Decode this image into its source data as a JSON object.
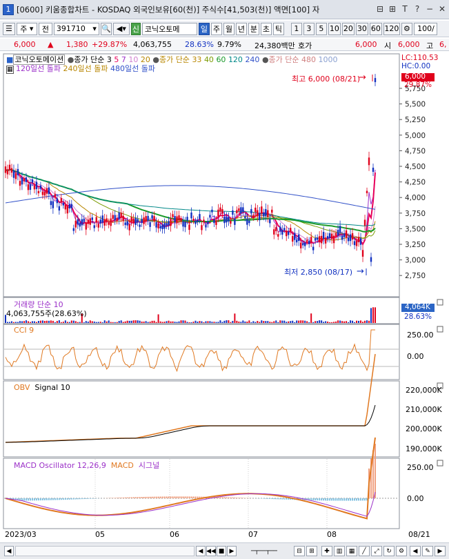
{
  "window": {
    "number": "1",
    "title": "[0600] 키움종합차트 - KOSDAQ 외국인보유[60(천)] 주식수[41,503(천)] 액면[100] 자",
    "buttons": [
      "⊟",
      "⊞",
      "T",
      "?",
      "−",
      "✕"
    ]
  },
  "toolbar": {
    "market": "주",
    "period_type": "전",
    "code": "391710",
    "sin_badge": "신",
    "stock_name": "코닉오토메",
    "tabs": [
      "일",
      "주",
      "월",
      "년",
      "분",
      "초",
      "틱"
    ],
    "active_tab": "일",
    "ticks": [
      "1",
      "3",
      "5",
      "10",
      "20",
      "30",
      "60",
      "120"
    ],
    "count": "100/"
  },
  "pricebar": {
    "price": "6,000",
    "change": "1,380",
    "change_pct": "+29.87%",
    "volume": "4,063,755",
    "turnover": "28.63%",
    "foreign": "9.79%",
    "amount": "24,380백만",
    "hoga_label": "호가",
    "ask": "6,000",
    "si_label": "시",
    "open": "6,000",
    "go_label": "고",
    "high": "6,"
  },
  "main_legend": {
    "stock": "코닉오토메이션",
    "ma_label": "종가 단순",
    "ma_short": [
      "3",
      "5",
      "7",
      "10",
      "20"
    ],
    "ma_label2": "종가 단순",
    "ma_long": [
      "33",
      "40",
      "60",
      "120",
      "240"
    ],
    "ma_label3": "종가 단순",
    "ma_480": "480",
    "ma_1000": "1000",
    "break_20": "120일선 돌파",
    "break_240": "240일선 돌파",
    "break_480": "480일선 돌파"
  },
  "price_axis": {
    "labels": [
      "5,750",
      "5,500",
      "5,250",
      "5,000",
      "4,750",
      "4,500",
      "4,250",
      "4,000",
      "3,750",
      "3,500",
      "3,250",
      "3,000",
      "2,750"
    ],
    "lc": "LC:110.53",
    "hc": "HC:0.00",
    "current": "6,000",
    "current_pct": "29.87%"
  },
  "annotations": {
    "high": "최고 6,000 (08/21)",
    "low": "최저 2,850 (08/17)"
  },
  "volume_panel": {
    "title": "거래량",
    "ma": "단순 10",
    "value": "4,063,755주(28.63%)",
    "axis_value": "4,064K",
    "axis_pct": "28.63%"
  },
  "cci_panel": {
    "title": "CCI 9",
    "labels": [
      "250.00",
      "0.00"
    ]
  },
  "obv_panel": {
    "title": "OBV",
    "signal": "Signal 10",
    "labels": [
      "220,000K",
      "210,000K",
      "200,000K",
      "190,000K"
    ]
  },
  "macd_panel": {
    "title": "MACD Oscillator 12,26,9",
    "macd": "MACD",
    "signal": "시그널",
    "labels": [
      "250.00",
      "0.00"
    ]
  },
  "date_axis": {
    "labels": [
      "2023/03",
      "05",
      "06",
      "07",
      "08"
    ],
    "end": "08/21"
  },
  "colors": {
    "up": "#e0001b",
    "down": "#1030c0",
    "ma5": "#e8005a",
    "ma20": "#b88600",
    "ma60": "#1a9a2a",
    "ma240": "#3050c8",
    "cci": "#e07820",
    "obv": "#e07820"
  }
}
